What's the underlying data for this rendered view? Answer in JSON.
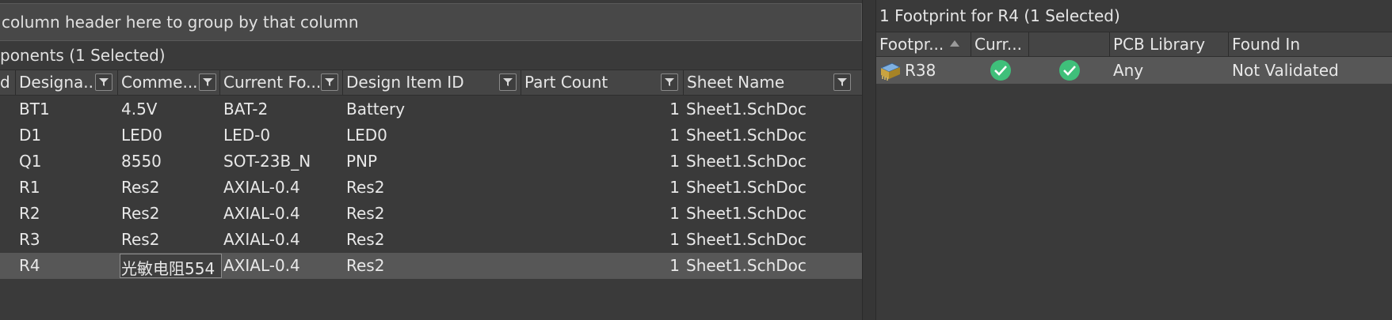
{
  "left_panel": {
    "group_hint": "column header here to group by that column",
    "components_title": "ponents (1 Selected)",
    "columns": [
      "d",
      "Designa...",
      "Comme...",
      "Current Fo...",
      "Design Item ID",
      "Part Count",
      "Sheet Name"
    ],
    "rows": [
      {
        "designator": "BT1",
        "comment": "4.5V",
        "footprint": "BAT-2",
        "design_item_id": "Battery",
        "part_count": "1",
        "sheet": "Sheet1.SchDoc"
      },
      {
        "designator": "D1",
        "comment": "LED0",
        "footprint": "LED-0",
        "design_item_id": "LED0",
        "part_count": "1",
        "sheet": "Sheet1.SchDoc"
      },
      {
        "designator": "Q1",
        "comment": "8550",
        "footprint": "SOT-23B_N",
        "design_item_id": "PNP",
        "part_count": "1",
        "sheet": "Sheet1.SchDoc"
      },
      {
        "designator": "R1",
        "comment": "Res2",
        "footprint": "AXIAL-0.4",
        "design_item_id": "Res2",
        "part_count": "1",
        "sheet": "Sheet1.SchDoc"
      },
      {
        "designator": "R2",
        "comment": "Res2",
        "footprint": "AXIAL-0.4",
        "design_item_id": "Res2",
        "part_count": "1",
        "sheet": "Sheet1.SchDoc"
      },
      {
        "designator": "R3",
        "comment": "Res2",
        "footprint": "AXIAL-0.4",
        "design_item_id": "Res2",
        "part_count": "1",
        "sheet": "Sheet1.SchDoc"
      },
      {
        "designator": "R4",
        "comment": "光敏电阻554",
        "footprint": "AXIAL-0.4",
        "design_item_id": "Res2",
        "part_count": "1",
        "sheet": "Sheet1.SchDoc",
        "selected": true
      }
    ]
  },
  "right_panel": {
    "title": "1 Footprint for R4 (1 Selected)",
    "columns": [
      "Footpr...",
      "Curr...",
      "",
      "PCB Library",
      "Found In"
    ],
    "rows": [
      {
        "footprint": "R38",
        "current": "check-icon",
        "col3": "check-icon",
        "pcb_library": "Any",
        "found_in": "Not Validated"
      }
    ]
  },
  "colors": {
    "background": "#3a3a3a",
    "header": "#454545",
    "selected_row": "#575757",
    "check": "#3fbf7a"
  }
}
